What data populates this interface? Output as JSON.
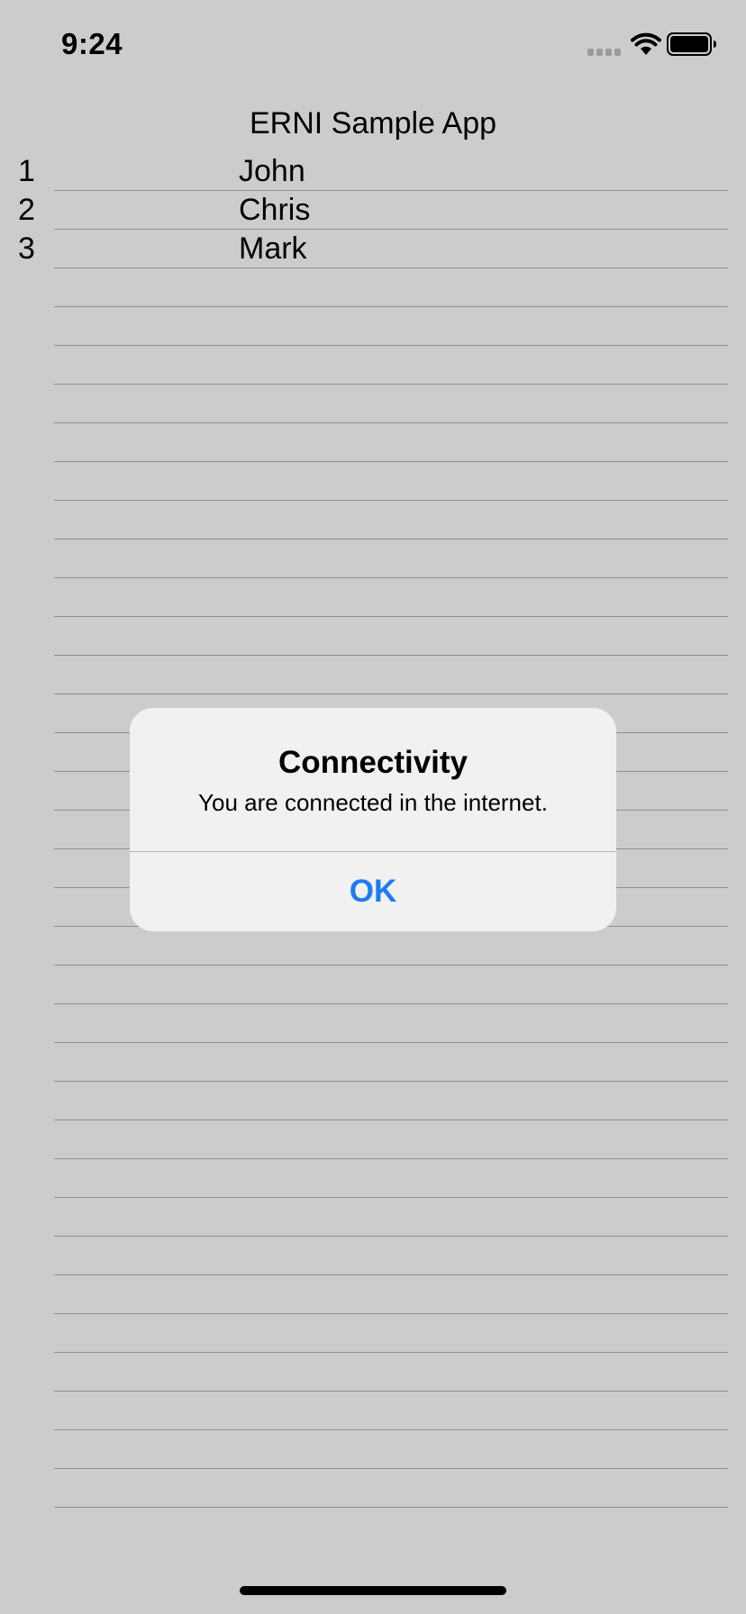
{
  "status_bar": {
    "time": "9:24"
  },
  "app": {
    "title": "ERNI Sample App"
  },
  "list": {
    "items": [
      {
        "number": "1",
        "name": "John"
      },
      {
        "number": "2",
        "name": "Chris"
      },
      {
        "number": "3",
        "name": "Mark"
      }
    ],
    "empty_rows": 32
  },
  "alert": {
    "title": "Connectivity",
    "message": "You are connected in the internet.",
    "ok_label": "OK"
  },
  "colors": {
    "background": "#cccccc",
    "alert_background": "#f1f1f1",
    "accent": "#1a7cf5",
    "separator": "#8f8f8f"
  },
  "icons": [
    "cellular-signal-icon",
    "wifi-icon",
    "battery-icon"
  ]
}
